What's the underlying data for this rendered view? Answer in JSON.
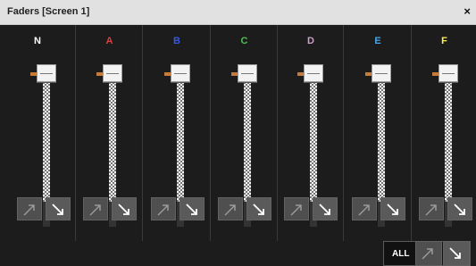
{
  "window": {
    "title": "Faders [Screen 1]",
    "close_label": "×"
  },
  "channels": [
    {
      "label": "N",
      "color": "#ffffff",
      "level": 0.92
    },
    {
      "label": "A",
      "color": "#e43d3d",
      "level": 0.92
    },
    {
      "label": "B",
      "color": "#3858e6",
      "level": 0.92
    },
    {
      "label": "C",
      "color": "#4fbf4f",
      "level": 0.92
    },
    {
      "label": "D",
      "color": "#c8a0c4",
      "level": 0.92
    },
    {
      "label": "E",
      "color": "#45a5ea",
      "level": 0.92
    },
    {
      "label": "F",
      "color": "#ffef52",
      "level": 0.92
    }
  ],
  "all_group": {
    "label": "ALL"
  }
}
